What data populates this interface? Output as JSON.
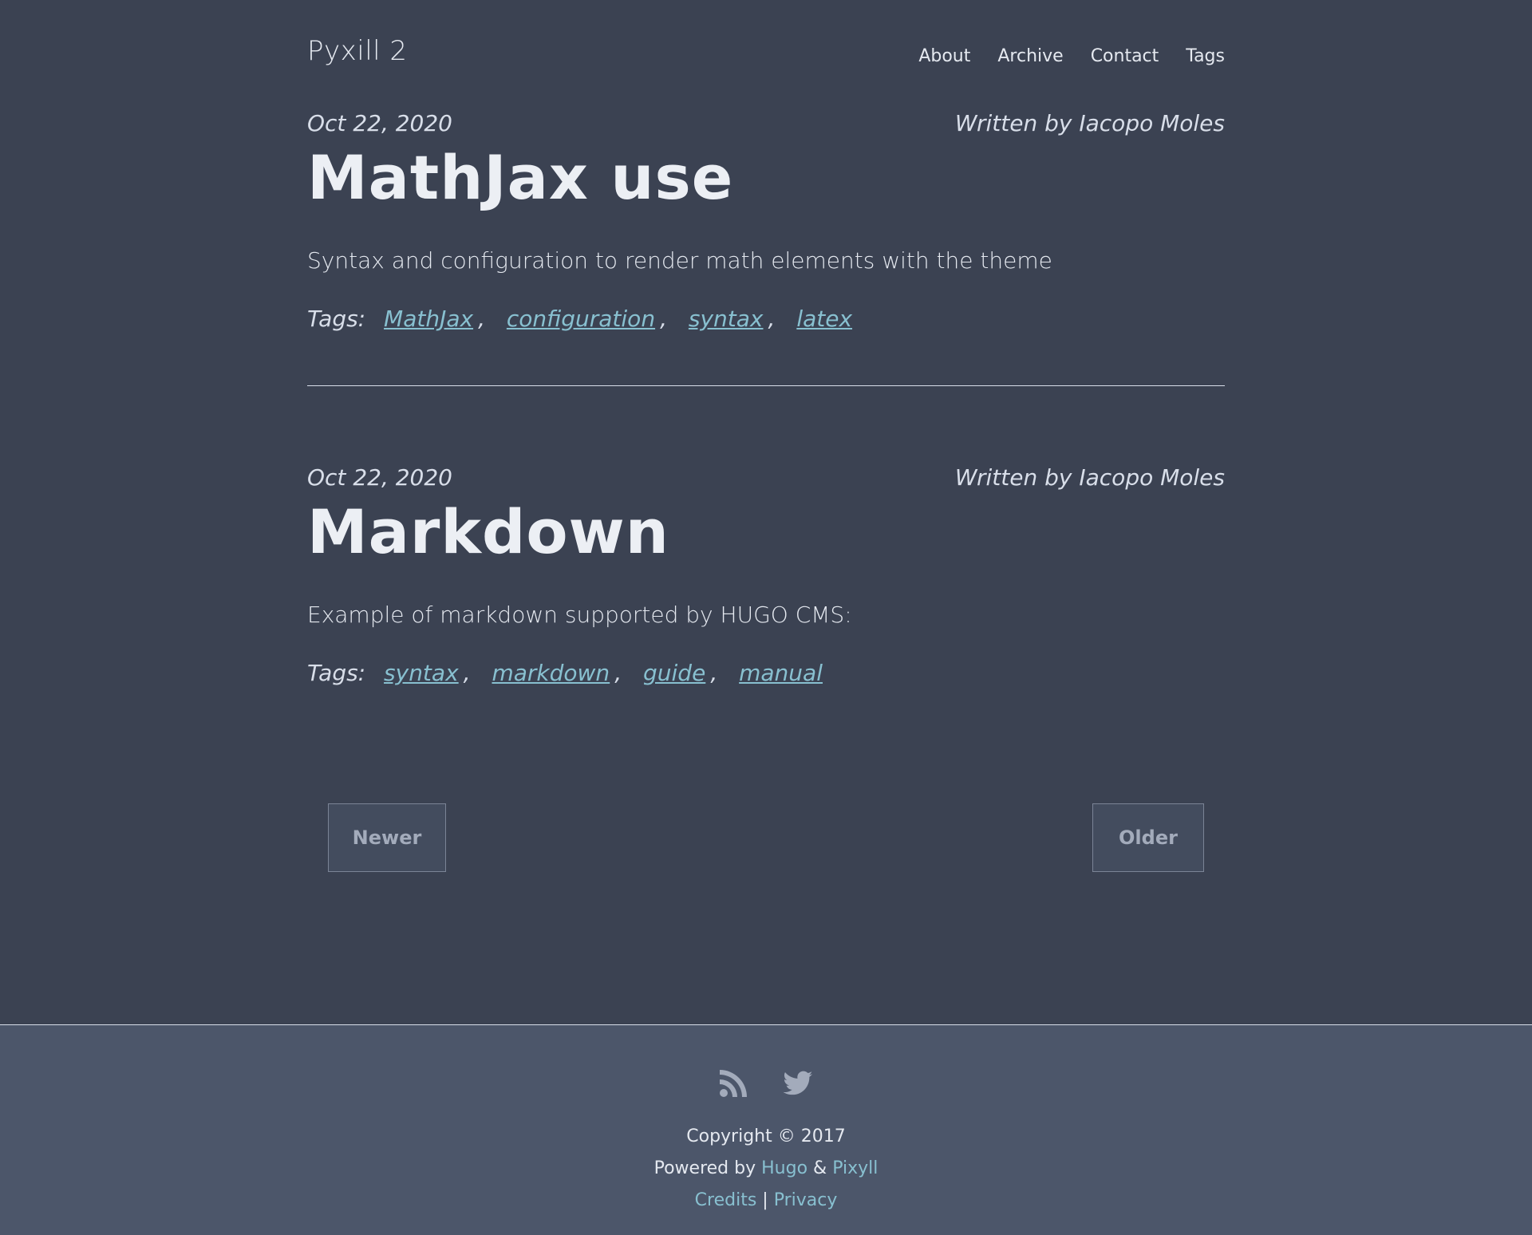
{
  "header": {
    "site_title": "Pyxill 2",
    "nav": [
      "About",
      "Archive",
      "Contact",
      "Tags"
    ]
  },
  "posts": [
    {
      "date": "Oct 22, 2020",
      "author": "Written by Iacopo Moles",
      "title": "MathJax use",
      "summary": "Syntax and configuration to render math elements with the theme",
      "tags_label": "Tags:",
      "tags": [
        "MathJax",
        "configuration",
        "syntax",
        "latex"
      ]
    },
    {
      "date": "Oct 22, 2020",
      "author": "Written by Iacopo Moles",
      "title": "Markdown",
      "summary": "Example of markdown supported by HUGO CMS:",
      "tags_label": "Tags:",
      "tags": [
        "syntax",
        "markdown",
        "guide",
        "manual"
      ]
    }
  ],
  "pagination": {
    "newer": "Newer",
    "older": "Older"
  },
  "footer": {
    "icons": [
      "rss-icon",
      "twitter-icon"
    ],
    "copyright": "Copyright © 2017",
    "powered_prefix": "Powered by ",
    "hugo": "Hugo",
    "amp": " & ",
    "pixyll": "Pixyll",
    "credits": "Credits",
    "bar": " | ",
    "privacy": "Privacy"
  },
  "colors": {
    "background": "#3b4252",
    "footer_bg": "#4c566a",
    "link": "#88c0d0",
    "text": "#e5e9f0"
  }
}
